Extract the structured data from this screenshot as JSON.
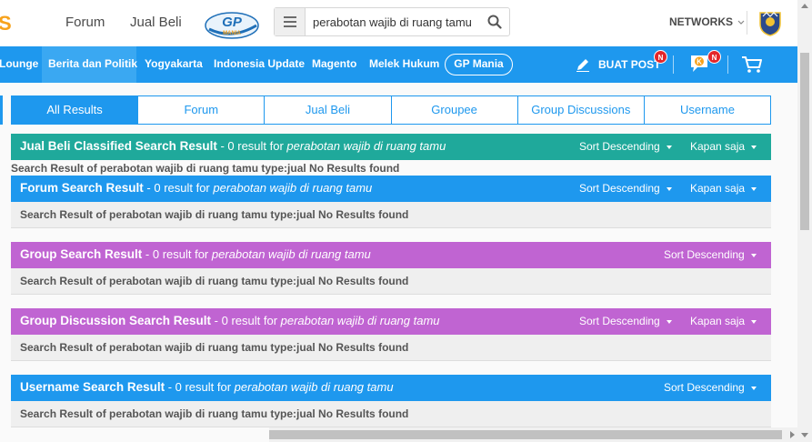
{
  "header": {
    "logo_fragment": "S",
    "nav": [
      "Forum",
      "Jual Beli"
    ],
    "gp_logo_text": "GP",
    "gp_logo_sub": "MANIA",
    "search": {
      "value": "perabotan wajib di ruang tamu"
    },
    "networks_label": "NETWORKS"
  },
  "navbar": {
    "items": [
      "Lounge",
      "Berita dan Politik",
      "Yogyakarta",
      "Indonesia Update",
      "Magento",
      "Melek Hukum"
    ],
    "gpmania_label": "GP Mania",
    "buat_post_label": "BUAT POST",
    "badge_post": "N",
    "badge_k": "N"
  },
  "tabs": [
    "All Results",
    "Forum",
    "Jual Beli",
    "Groupee",
    "Group Discussions",
    "Username"
  ],
  "sections": [
    {
      "title": "Jual Beli Classified Search Result",
      "count_text": " - 0 result for ",
      "query": "perabotan wajib di ruang tamu",
      "sort_label": "Sort Descending",
      "time_label": "Kapan saja",
      "body": "Search Result of perabotan wajib di ruang tamu type:jual No Results found"
    },
    {
      "title": "Forum Search Result",
      "count_text": " - 0 result for ",
      "query": "perabotan wajib di ruang tamu",
      "sort_label": "Sort Descending",
      "time_label": "Kapan saja",
      "body": "Search Result of perabotan wajib di ruang tamu type:jual No Results found"
    },
    {
      "title": "Group Search Result",
      "count_text": " - 0 result for ",
      "query": "perabotan wajib di ruang tamu",
      "sort_label": "Sort Descending",
      "body": "Search Result of perabotan wajib di ruang tamu type:jual No Results found"
    },
    {
      "title": "Group Discussion Search Result",
      "count_text": " - 0 result for ",
      "query": "perabotan wajib di ruang tamu",
      "sort_label": "Sort Descending",
      "time_label": "Kapan saja",
      "body": "Search Result of perabotan wajib di ruang tamu type:jual No Results found"
    },
    {
      "title": "Username Search Result",
      "count_text": " - 0 result for ",
      "query": "perabotan wajib di ruang tamu",
      "sort_label": "Sort Descending",
      "body": "Search Result of perabotan wajib di ruang tamu type:jual No Results found"
    }
  ],
  "colors": {
    "primary_blue": "#1e98ee",
    "teal": "#1fa99b",
    "purple": "#c064d2",
    "logo_orange": "#f7a21b",
    "badge_red": "#e4262a"
  }
}
